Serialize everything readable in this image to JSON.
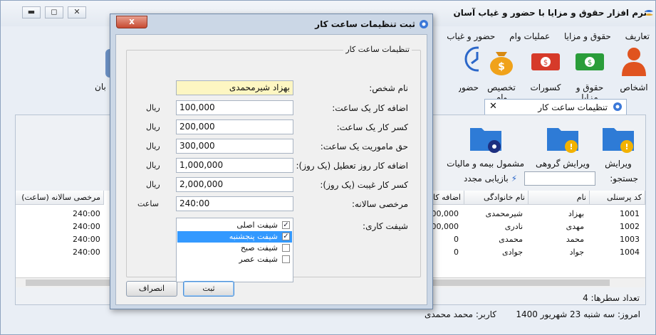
{
  "app": {
    "title": "نرم افزار حقوق و مزایا با حضور و غیاب آسان",
    "menu": [
      "تعاریف",
      "حقوق و مزایا",
      "عملیات وام",
      "حضور و غیاب"
    ],
    "ribbon": [
      "اشخاص",
      "حقوق و مزایا",
      "کسورات",
      "تخصیص وام",
      "حضور"
    ],
    "ribbon_left_label": "بان",
    "doc_tab": "تنظیمات ساعت کار",
    "tools": [
      "ویرایش",
      "ویرایش گروهی",
      "مشمول بیمه و مالیات"
    ],
    "search_label": "جستجو:",
    "refresh_label": "بازیابی مجدد",
    "grid": {
      "columns": [
        "کد پرسنلی",
        "نام",
        "نام خانوادگی",
        "اضافه کار (ریال)",
        "مرخصی سالانه (ساعت)"
      ],
      "rows": [
        {
          "code": "1001",
          "name": "بهزاد",
          "family": "شیرمحمدی",
          "overtime": "100,000",
          "leave": "240:00"
        },
        {
          "code": "1002",
          "name": "مهدی",
          "family": "نادری",
          "overtime": "100,000",
          "leave": "240:00"
        },
        {
          "code": "1003",
          "name": "محمد",
          "family": "محمدی",
          "overtime": "0",
          "leave": "240:00"
        },
        {
          "code": "1004",
          "name": "جواد",
          "family": "جوادی",
          "overtime": "0",
          "leave": "240:00"
        }
      ]
    },
    "row_count_label": "تعداد سطرها:",
    "row_count": "4",
    "status_date": "امروز: سه شنبه 23 شهریور 1400",
    "status_user": "کاربر: محمد محمدی"
  },
  "dialog": {
    "title": "ثبت تنظیمات ساعت کار",
    "close": "x",
    "group_title": "تنظیمات ساعت کار",
    "fields": [
      {
        "label": "نام شخص:",
        "value": "بهزاد شیرمحمدی",
        "unit": ""
      },
      {
        "label": "اضافه کار یک ساعت:",
        "value": "100,000",
        "unit": "ریال"
      },
      {
        "label": "کسر کار یک ساعت:",
        "value": "200,000",
        "unit": "ریال"
      },
      {
        "label": "حق ماموریت یک ساعت:",
        "value": "300,000",
        "unit": "ریال"
      },
      {
        "label": "اضافه کار روز تعطیل (یک روز):",
        "value": "1,000,000",
        "unit": "ریال"
      },
      {
        "label": "کسر کار غیبت (یک روز):",
        "value": "2,000,000",
        "unit": "ریال"
      },
      {
        "label": "مرخصی سالانه:",
        "value": "240:00",
        "unit": "ساعت"
      }
    ],
    "shift_label": "شیفت کاری:",
    "shifts": [
      {
        "label": "شیفت اصلی",
        "checked": true,
        "selected": false
      },
      {
        "label": "شیفت پنجشنبه",
        "checked": true,
        "selected": true
      },
      {
        "label": "شیفت صبح",
        "checked": false,
        "selected": false
      },
      {
        "label": "شیفت عصر",
        "checked": false,
        "selected": false
      }
    ],
    "ok": "ثبت",
    "cancel": "انصراف"
  },
  "colors": {
    "accent": "#3399ff",
    "close": "#c74a31",
    "name_field": "#fdf6c2"
  }
}
